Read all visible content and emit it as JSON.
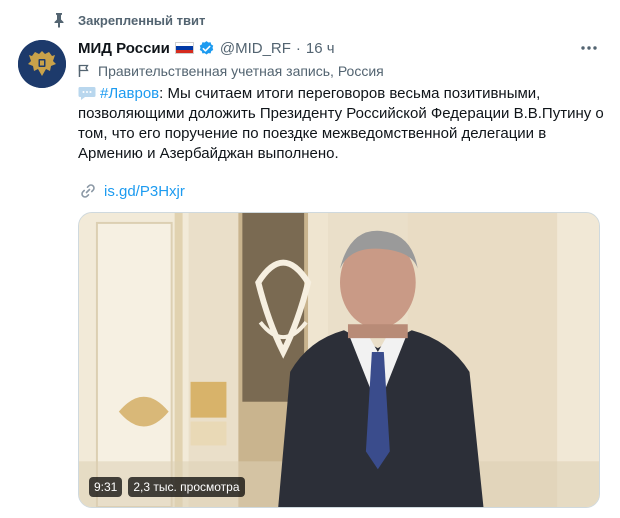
{
  "pinned": {
    "label": "Закрепленный твит",
    "icon": "pin-icon"
  },
  "tweet": {
    "author_name": "МИД России",
    "handle": "@MID_RF",
    "separator": "·",
    "time": "16 ч",
    "more_icon": "more-icon",
    "government_label": "Правительственная учетная запись, Россия",
    "hashtag": "#Лавров",
    "body": ": Мы считаем итоги переговоров весьма позитивными, позволяющими доложить Президенту Российской Федерации В.В.Путину о том, что его поручение по поездке межведомственной делегации в Армению и Азербайджан выполнено.",
    "link": "is.gd/P3Hxjr"
  },
  "video": {
    "duration": "9:31",
    "views": "2,3 тыс. просмотра"
  },
  "colors": {
    "link": "#1d9bf0",
    "secondary_text": "#536471",
    "avatar_bg": "#1d3a6b",
    "flag_white": "#ffffff",
    "flag_blue": "#0039a6",
    "flag_red": "#d52b1e"
  }
}
